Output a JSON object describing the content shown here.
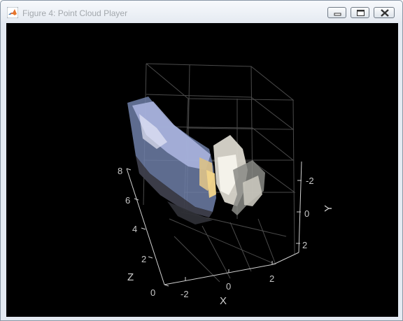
{
  "window": {
    "title": "Figure 4: Point Cloud Player",
    "icon": "matlab-icon",
    "controls": [
      "minimize-icon",
      "maximize-icon",
      "close-icon"
    ]
  },
  "axes": {
    "x": {
      "label": "X",
      "ticks": [
        "-2",
        "0",
        "2"
      ]
    },
    "y": {
      "label": "Y",
      "ticks": [
        "-2",
        "0",
        "2"
      ]
    },
    "z": {
      "label": "Z",
      "ticks": [
        "0",
        "2",
        "4",
        "6",
        "8"
      ]
    }
  },
  "colors": {
    "canvas": "#000000",
    "grid": "#4a4a4a",
    "box": "#d0d0d0",
    "tick_text": "#c8c8c8",
    "titlebar": "#e6ebf2"
  }
}
